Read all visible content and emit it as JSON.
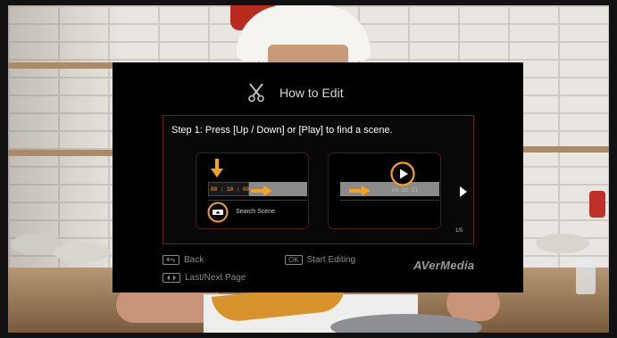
{
  "dialog": {
    "title": "How to Edit",
    "step_text": "Step 1: Press [Up / Down] or [Play]  to find a scene.",
    "panel1": {
      "timecode": "00 : 10 : 00",
      "search_label": "Search Scene"
    },
    "panel2": {
      "timecode": "00:33:21"
    },
    "page_indicator": "1/5"
  },
  "footer": {
    "back_label": "Back",
    "start_key": "OK",
    "start_label": "Start Editing",
    "page_label": "Last/Next Page"
  },
  "brand": "AVerMedia",
  "colors": {
    "accent_orange": "#f7a21b",
    "border_red": "#6b1e1e",
    "dialog_bg": "#000000"
  },
  "icons": [
    "scissors-icon",
    "down-arrow-icon",
    "right-arrow-icon",
    "updown-button-icon",
    "play-circle-icon",
    "next-icon",
    "back-key-icon",
    "page-keys-icon"
  ]
}
